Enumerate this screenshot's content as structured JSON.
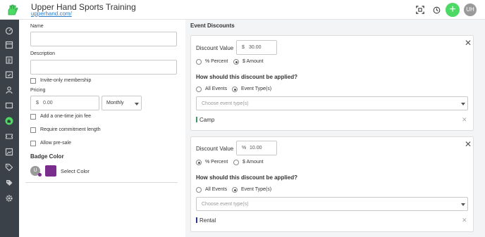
{
  "header": {
    "title": "Upper Hand Sports Training",
    "url": "upperhand.com/",
    "add_label": "+",
    "avatar_initials": "UH",
    "icons": [
      "qr-scan-icon",
      "clock-icon"
    ]
  },
  "sidebar": {
    "items": [
      "dashboard-icon",
      "calendar-icon",
      "clipboard-icon",
      "calendar-check-icon",
      "team-icon",
      "reports-icon",
      "upper-hand-icon",
      "tickets-icon",
      "gallery-icon",
      "tag-icon",
      "price-tag-icon",
      "settings-icon"
    ]
  },
  "form": {
    "name_label": "Name",
    "name_value": "",
    "description_label": "Description",
    "description_value": "",
    "invite_only_label": "Invite-only membership",
    "pricing_label": "Pricing",
    "currency_symbol": "$",
    "price_value": "0.00",
    "interval_value": "Monthly",
    "join_fee_label": "Add a one-time join fee",
    "commitment_label": "Require commitment length",
    "presale_label": "Allow pre-sale",
    "badge_color_label": "Badge Color",
    "badge_initial": "U",
    "badge_color": "#7b2d8e",
    "select_color_label": "Select Color"
  },
  "discounts": {
    "title": "Event Discounts",
    "cards": [
      {
        "value_label": "Discount Value",
        "value_prefix": "$",
        "value": "30.00",
        "percent_label": "% Percent",
        "amount_label": "$ Amount",
        "selected_type": "amount",
        "question": "How should this discount be applied?",
        "all_events_label": "All Events",
        "event_types_label": "Event Type(s)",
        "applied_to": "event_types",
        "select_placeholder": "Choose event type(s)",
        "tag": "Camp",
        "tag_color": "#3a9a63"
      },
      {
        "value_label": "Discount Value",
        "value_prefix": "%",
        "value": "10.00",
        "percent_label": "% Percent",
        "amount_label": "$ Amount",
        "selected_type": "percent",
        "question": "How should this discount be applied?",
        "all_events_label": "All Events",
        "event_types_label": "Event Type(s)",
        "applied_to": "event_types",
        "select_placeholder": "Choose event type(s)",
        "tag": "Rental",
        "tag_color": "#2b3a8c"
      }
    ]
  }
}
